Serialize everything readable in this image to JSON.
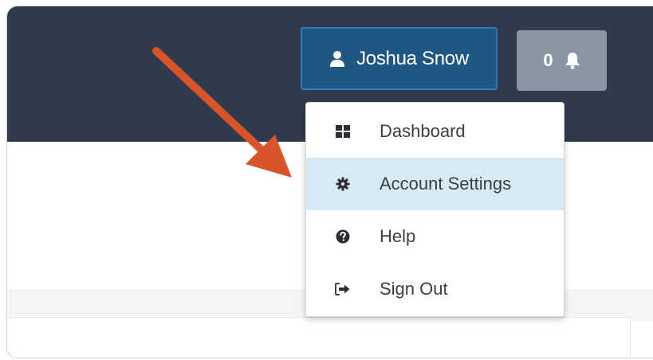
{
  "header": {
    "user_button_label": "Joshua Snow",
    "notification_count": "0"
  },
  "dropdown": {
    "items": [
      {
        "label": "Dashboard",
        "icon": "dashboard-grid-icon"
      },
      {
        "label": "Account Settings",
        "icon": "gear-icon",
        "highlighted": true
      },
      {
        "label": "Help",
        "icon": "question-circle-icon"
      },
      {
        "label": "Sign Out",
        "icon": "sign-out-icon"
      }
    ]
  },
  "annotation": {
    "arrow_color": "#d9532b"
  },
  "colors": {
    "topbar": "#2f3b4d",
    "user_button": "#1f5783",
    "user_button_border": "#2f79b8",
    "notification_button": "#8a95a4",
    "highlight": "#d7e9f3"
  }
}
